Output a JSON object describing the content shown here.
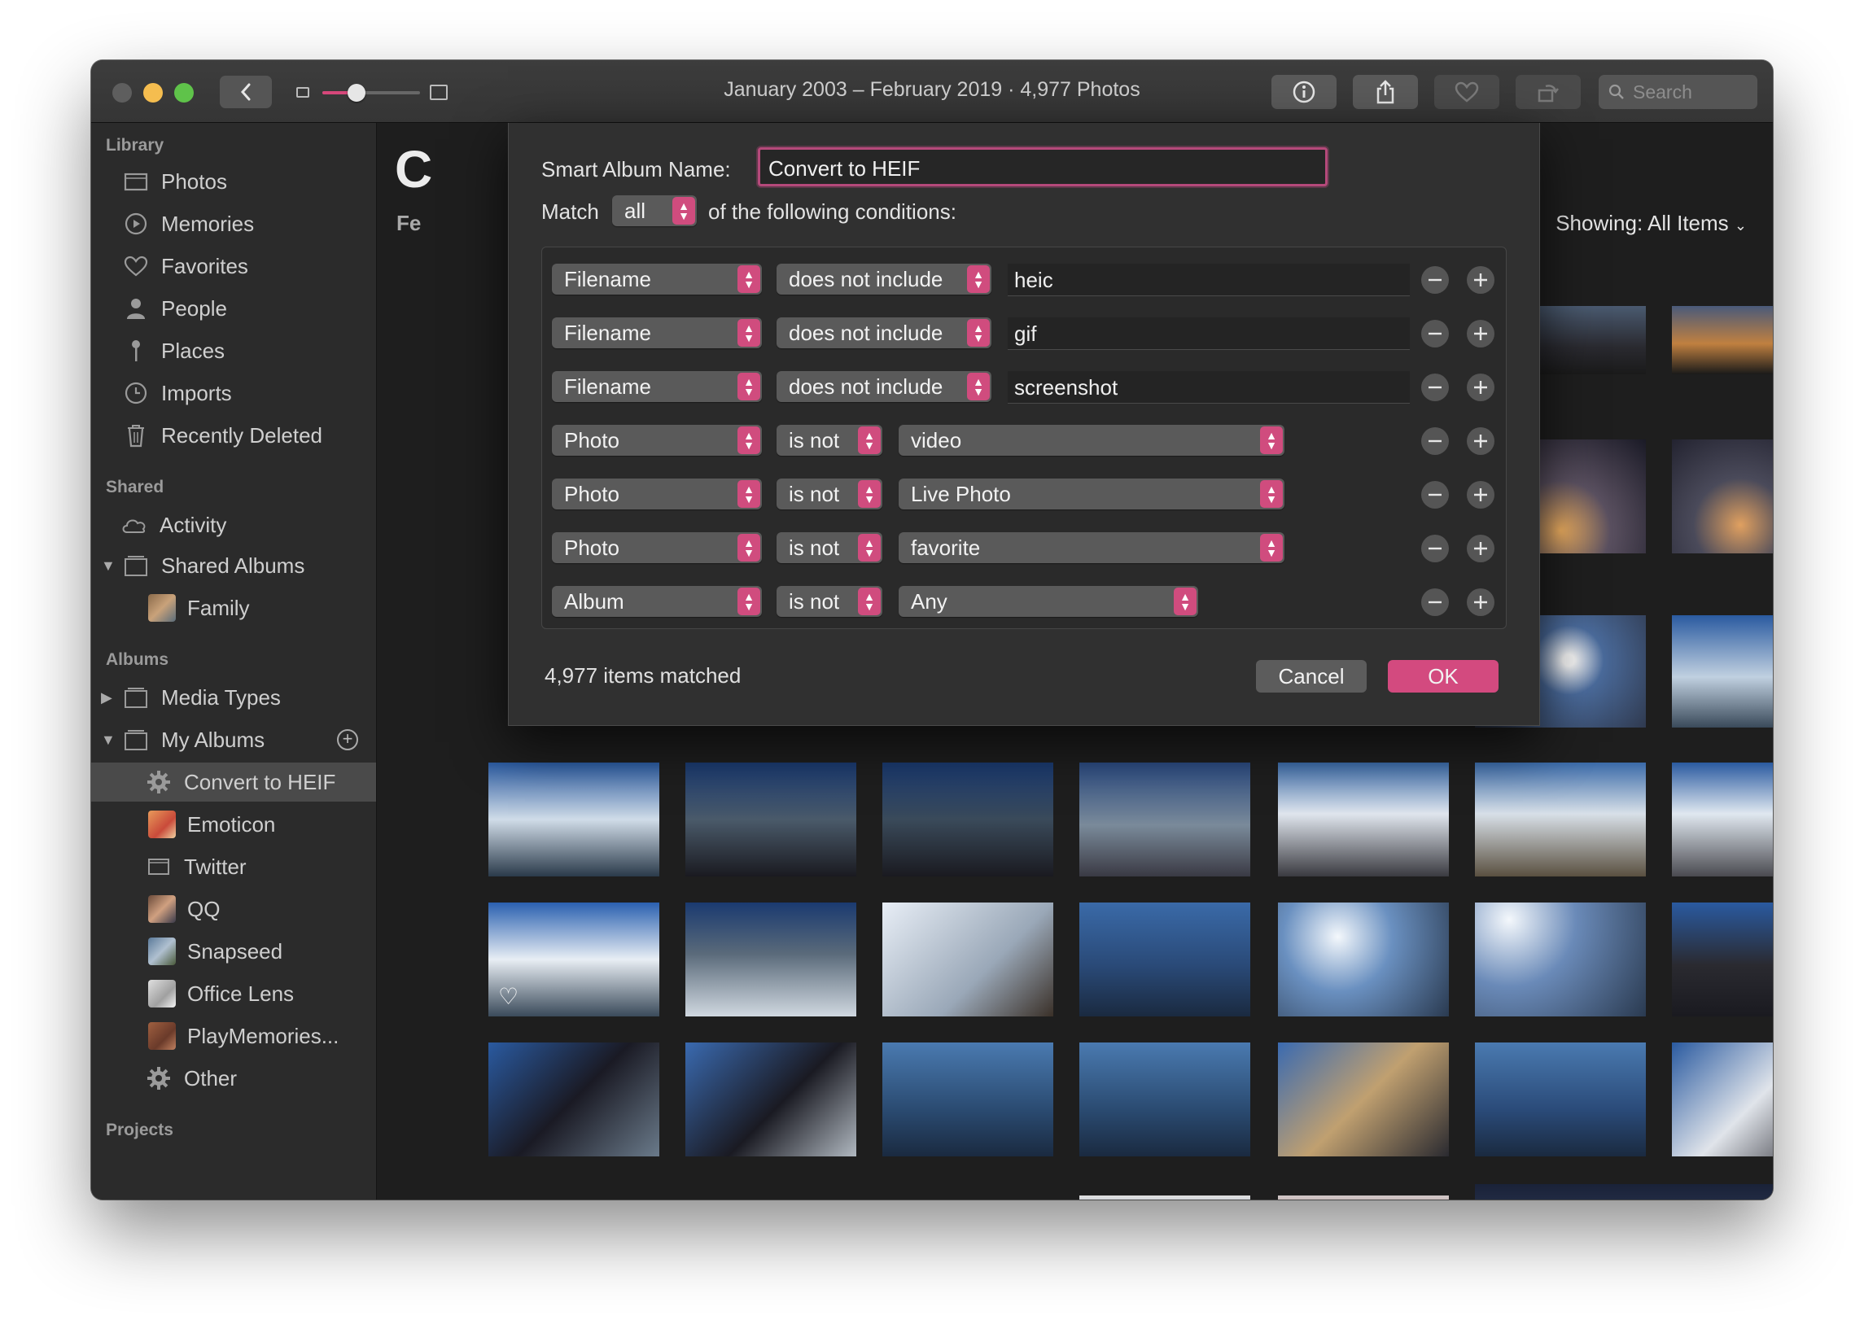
{
  "window": {
    "title": "January 2003 – February 2019 · 4,977 Photos",
    "search_placeholder": "Search",
    "zoom_level": 0.35
  },
  "sidebar": {
    "library_header": "Library",
    "library_items": [
      "Photos",
      "Memories",
      "Favorites",
      "People",
      "Places",
      "Imports",
      "Recently Deleted"
    ],
    "shared_header": "Shared",
    "shared_items": [
      "Activity",
      "Shared Albums",
      "Family"
    ],
    "albums_header": "Albums",
    "albums_items": [
      "Media Types",
      "My Albums"
    ],
    "my_albums": [
      "Convert to HEIF",
      "Emoticon",
      "Twitter",
      "QQ",
      "Snapseed",
      "Office Lens",
      "PlayMemories...",
      "Other"
    ],
    "projects_header": "Projects"
  },
  "content": {
    "title_fragment": "C",
    "subtitle_fragment": "Fe",
    "showing_label": "Showing:",
    "showing_value": "All Items"
  },
  "dialog": {
    "name_label": "Smart Album Name:",
    "name_value": "Convert to HEIF",
    "match_label": "Match",
    "match_value": "all",
    "match_suffix": "of the following conditions:",
    "conditions": [
      {
        "field": "Filename",
        "operator": "does not include",
        "value": "heic",
        "value_type": "text"
      },
      {
        "field": "Filename",
        "operator": "does not include",
        "value": "gif",
        "value_type": "text"
      },
      {
        "field": "Filename",
        "operator": "does not include",
        "value": "screenshot",
        "value_type": "text"
      },
      {
        "field": "Photo",
        "operator": "is not",
        "value": "video",
        "value_type": "popup"
      },
      {
        "field": "Photo",
        "operator": "is not",
        "value": "Live Photo",
        "value_type": "popup"
      },
      {
        "field": "Photo",
        "operator": "is not",
        "value": "favorite",
        "value_type": "popup"
      },
      {
        "field": "Album",
        "operator": "is not",
        "value": "Any",
        "value_type": "popup"
      }
    ],
    "matched_text": "4,977 items matched",
    "cancel_label": "Cancel",
    "ok_label": "OK"
  },
  "colors": {
    "accent": "#d04c7e",
    "window_bg": "#1e1e1e",
    "sidebar_bg": "#2b2b2b",
    "dialog_bg": "#303030"
  }
}
